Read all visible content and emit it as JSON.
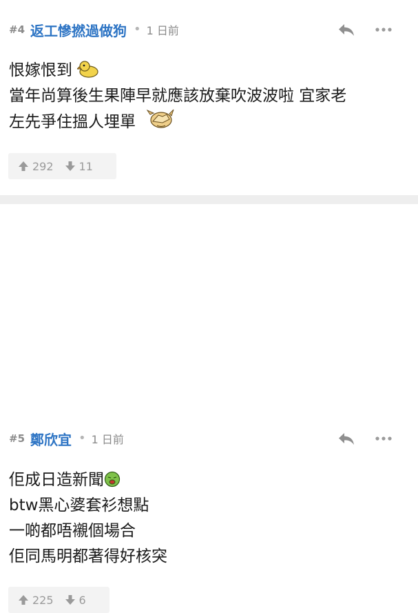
{
  "posts": [
    {
      "number": "#4",
      "username": "返工慘撚過做狗",
      "time": "1 日前",
      "lines": [
        "恨嫁恨到",
        "當年尚算後生果陣早就應該放棄吹波波啦 宜家老",
        "左先爭住搵人埋單"
      ],
      "upvotes": "292",
      "downvotes": "11"
    },
    {
      "number": "#5",
      "username": "鄭欣宜",
      "time": "1 日前",
      "lines": [
        "佢成日造新聞",
        "btw黑心婆套衫想點",
        "一啲都唔襯個場合",
        "佢同馬明都著得好核突"
      ],
      "upvotes": "225",
      "downvotes": "6"
    }
  ],
  "colors": {
    "username": "#2d74c4",
    "meta": "#8a8a8a",
    "vote_bg": "#f3f3f3",
    "separator": "#eeeeee"
  },
  "icons": {
    "reply": "reply-icon",
    "more": "more-icon",
    "up": "arrow-up-icon",
    "down": "arrow-down-icon"
  }
}
